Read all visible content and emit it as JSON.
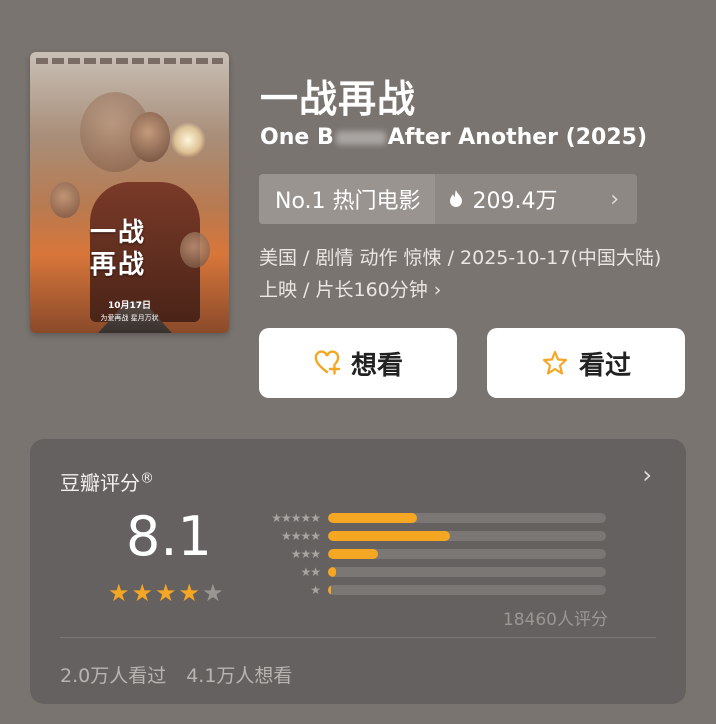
{
  "movie": {
    "title": "一战再战",
    "subtitle_start": "One B",
    "subtitle_end": "After Another (2025)",
    "poster": {
      "title": "一战再战",
      "date": "10月17日",
      "tagline": "为爱再战 星月万状"
    }
  },
  "rank": {
    "label": "No.1 热门电影",
    "hot_count": "209.4万",
    "chevron": "›"
  },
  "meta": {
    "info": "美国 / 剧情 动作 惊悚 / 2025-10-17(中国大陆)上映 / 片长160分钟 ›"
  },
  "actions": {
    "want_label": "想看",
    "seen_label": "看过"
  },
  "rating": {
    "title": "豆瓣评分",
    "registered": "®",
    "chevron": "›",
    "score": "8.1",
    "stars": 4,
    "count_text": "18460人评分",
    "distribution": [
      {
        "stars": 5,
        "percent": 32
      },
      {
        "stars": 4,
        "percent": 44
      },
      {
        "stars": 3,
        "percent": 18
      },
      {
        "stars": 2,
        "percent": 3
      },
      {
        "stars": 1,
        "percent": 1
      }
    ],
    "seen_text": "2.0万人看过",
    "want_text": "4.1万人想看"
  },
  "colors": {
    "accent": "#f5a623",
    "background": "#7a7470",
    "card": "#656160"
  }
}
